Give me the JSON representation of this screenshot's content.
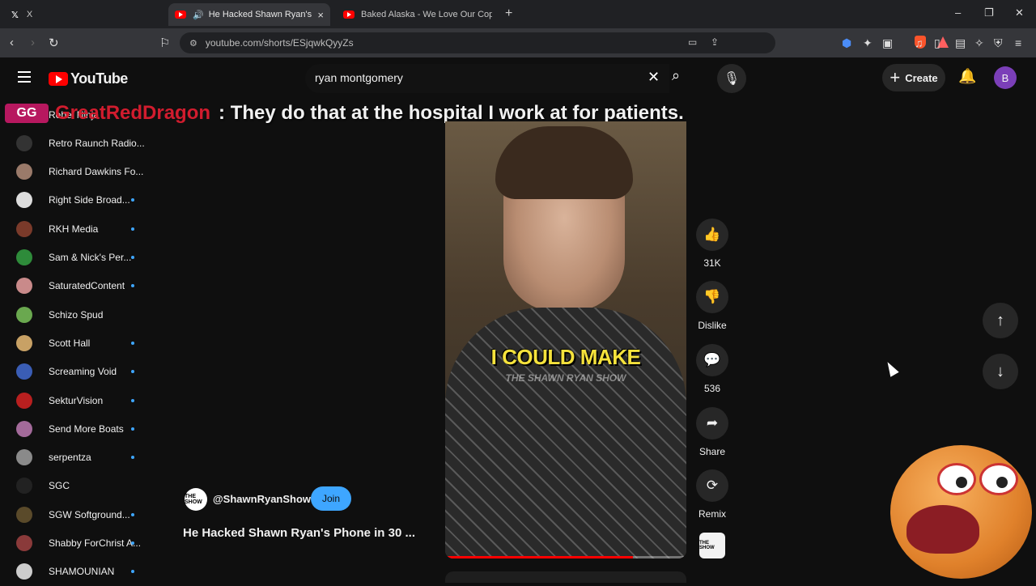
{
  "browser": {
    "tabs": [
      {
        "title": "X"
      },
      {
        "title": "He Hacked Shawn Ryan's Phone",
        "close": "×"
      },
      {
        "title": "Baked Alaska - We Love Our Cops [LI"
      }
    ],
    "new_tab": "+",
    "window": {
      "minimize": "–",
      "restore": "❐",
      "close": "✕"
    },
    "url": "youtube.com/shorts/ESjqwkQyyZs"
  },
  "masthead": {
    "logo": "YouTube",
    "search_value": "ryan montgomery",
    "clear": "✕",
    "search_icon": "⌕",
    "mic_icon": "🎙",
    "create_plus": "+",
    "create_label": "Create",
    "bell_icon": "🔔",
    "avatar_letter": "B"
  },
  "chat_overlay": {
    "badge": "GG",
    "user": "GreatRedDragon",
    "message": ": They do that at the hospital I work at for patients."
  },
  "sidebar": {
    "items": [
      {
        "label": "Rebel Ninja",
        "dot": false,
        "color": "#6b4b3b"
      },
      {
        "label": "Retro Raunch Radio...",
        "dot": false,
        "color": "#333333"
      },
      {
        "label": "Richard Dawkins Fo...",
        "dot": false,
        "color": "#9a7a6a"
      },
      {
        "label": "Right Side Broad...",
        "dot": true,
        "color": "#dddddd"
      },
      {
        "label": "RKH Media",
        "dot": true,
        "color": "#7a3a2a"
      },
      {
        "label": "Sam & Nick's Per...",
        "dot": true,
        "color": "#2e8b3a"
      },
      {
        "label": "SaturatedContent",
        "dot": true,
        "color": "#c98a8a"
      },
      {
        "label": "Schizo Spud",
        "dot": false,
        "color": "#6aa84f"
      },
      {
        "label": "Scott Hall",
        "dot": true,
        "color": "#c8a165"
      },
      {
        "label": "Screaming Void",
        "dot": true,
        "color": "#3a5db5"
      },
      {
        "label": "SekturVision",
        "dot": true,
        "color": "#b81f1f"
      },
      {
        "label": "Send More Boats",
        "dot": true,
        "color": "#a36a9a"
      },
      {
        "label": "serpentza",
        "dot": true,
        "color": "#8a8a8a"
      },
      {
        "label": "SGC",
        "dot": false,
        "color": "#222222"
      },
      {
        "label": "SGW Softground...",
        "dot": true,
        "color": "#5a4a2a"
      },
      {
        "label": "Shabby ForChrist A...",
        "dot": true,
        "color": "#8a3a3a"
      },
      {
        "label": "SHAMOUNIAN",
        "dot": true,
        "color": "#cccccc"
      }
    ]
  },
  "short": {
    "caption": "I COULD MAKE",
    "watermark": "THE SHAWN RYAN SHOW",
    "progress": 0.78,
    "channel_avatar": "THE SHOW",
    "channel": "@ShawnRyanShow",
    "join": "Join",
    "title": "He Hacked Shawn Ryan's Phone in 30 ...",
    "actions": {
      "like_icon": "👍",
      "like_count": "31K",
      "dislike_icon": "👎",
      "dislike_label": "Dislike",
      "comment_icon": "💬",
      "comment_count": "536",
      "share_icon": "➦",
      "share_label": "Share",
      "remix_icon": "⟳",
      "remix_label": "Remix",
      "sound_thumb": "THE SHOW"
    },
    "prev_icon": "↑",
    "next_icon": "↓"
  }
}
